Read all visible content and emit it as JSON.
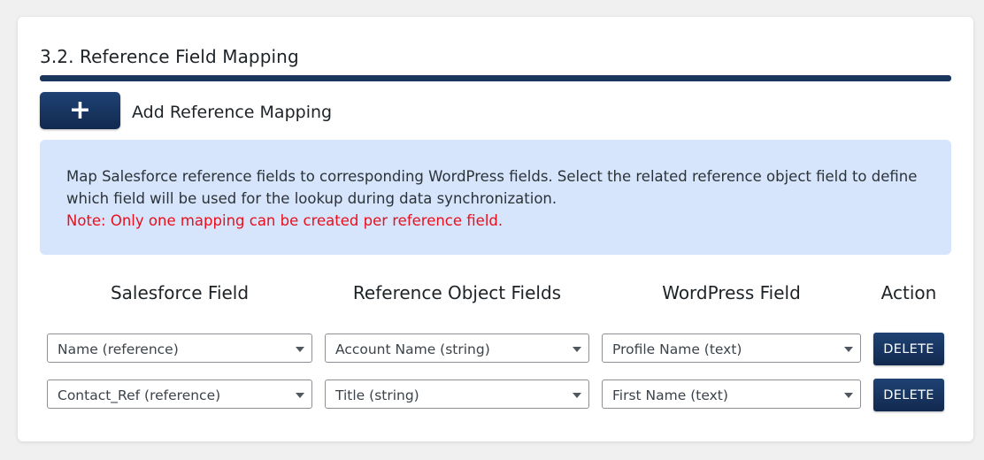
{
  "section": {
    "title": "3.2. Reference Field Mapping"
  },
  "add_mapping": {
    "button_icon": "plus-icon",
    "button_symbol": "+",
    "label": "Add Reference Mapping"
  },
  "info": {
    "text": "Map Salesforce reference fields to corresponding WordPress fields. Select the related reference object field to define which field will be used for the lookup during data synchronization.",
    "note": "Note: Only one mapping can be created per reference field."
  },
  "table": {
    "headers": {
      "salesforce_field": "Salesforce Field",
      "reference_object_fields": "Reference Object Fields",
      "wordpress_field": "WordPress Field",
      "action": "Action"
    },
    "rows": [
      {
        "salesforce_field": "Name (reference)",
        "reference_object_field": "Account Name (string)",
        "wordpress_field": "Profile Name (text)",
        "action": "DELETE"
      },
      {
        "salesforce_field": "Contact_Ref (reference)",
        "reference_object_field": "Title (string)",
        "wordpress_field": "First Name (text)",
        "action": "DELETE"
      }
    ]
  },
  "colors": {
    "accent": "#1b365d",
    "info_background": "#d6e4fc",
    "note_text": "#e8101c"
  }
}
